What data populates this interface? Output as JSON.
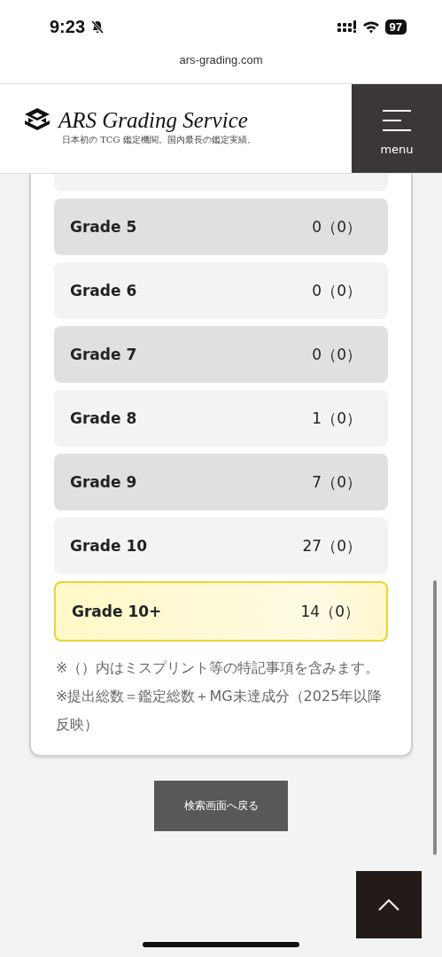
{
  "status_bar": {
    "time": "9:23",
    "battery": "97"
  },
  "url_bar": {
    "url": "ars-grading.com"
  },
  "header": {
    "logo": "ARS Grading Service",
    "tagline": "日本初の TCG 鑑定機関。国内最長の鑑定実績。",
    "menu_label": "menu"
  },
  "grades": [
    {
      "label": "Grade 5",
      "value": "0（0）",
      "highlighted": false
    },
    {
      "label": "Grade 6",
      "value": "0（0）",
      "highlighted": false
    },
    {
      "label": "Grade 7",
      "value": "0（0）",
      "highlighted": false
    },
    {
      "label": "Grade 8",
      "value": "1（0）",
      "highlighted": false
    },
    {
      "label": "Grade 9",
      "value": "7（0）",
      "highlighted": false
    },
    {
      "label": "Grade 10",
      "value": "27（0）",
      "highlighted": false
    },
    {
      "label": "Grade 10+",
      "value": "14（0）",
      "highlighted": true
    }
  ],
  "notes": [
    "※（）内はミスプリント等の特記事項を含みます。",
    "※提出総数＝鑑定総数＋MG未達成分（2025年以降反映）"
  ],
  "back_button": "検索画面へ戻る"
}
